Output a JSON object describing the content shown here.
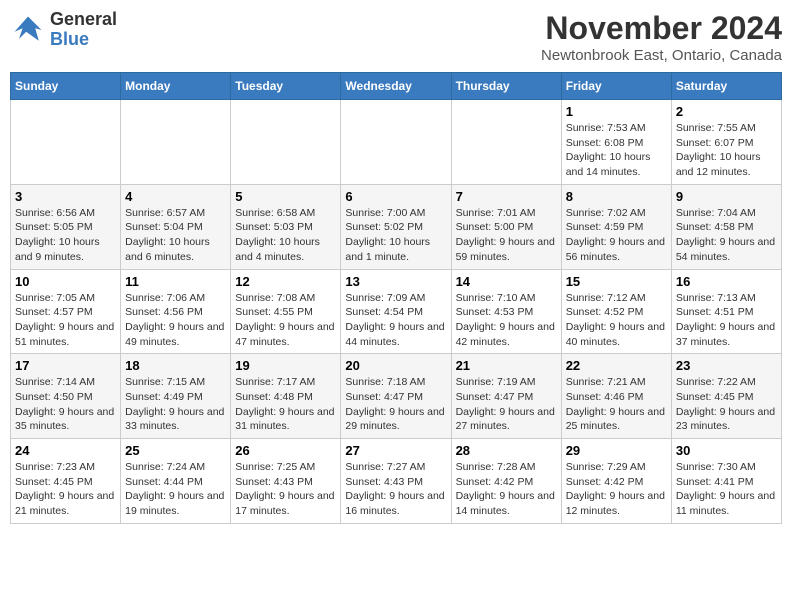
{
  "logo": {
    "line1": "General",
    "line2": "Blue"
  },
  "title": "November 2024",
  "subtitle": "Newtonbrook East, Ontario, Canada",
  "days_of_week": [
    "Sunday",
    "Monday",
    "Tuesday",
    "Wednesday",
    "Thursday",
    "Friday",
    "Saturday"
  ],
  "weeks": [
    [
      {
        "day": "",
        "info": ""
      },
      {
        "day": "",
        "info": ""
      },
      {
        "day": "",
        "info": ""
      },
      {
        "day": "",
        "info": ""
      },
      {
        "day": "",
        "info": ""
      },
      {
        "day": "1",
        "info": "Sunrise: 7:53 AM\nSunset: 6:08 PM\nDaylight: 10 hours and 14 minutes."
      },
      {
        "day": "2",
        "info": "Sunrise: 7:55 AM\nSunset: 6:07 PM\nDaylight: 10 hours and 12 minutes."
      }
    ],
    [
      {
        "day": "3",
        "info": "Sunrise: 6:56 AM\nSunset: 5:05 PM\nDaylight: 10 hours and 9 minutes."
      },
      {
        "day": "4",
        "info": "Sunrise: 6:57 AM\nSunset: 5:04 PM\nDaylight: 10 hours and 6 minutes."
      },
      {
        "day": "5",
        "info": "Sunrise: 6:58 AM\nSunset: 5:03 PM\nDaylight: 10 hours and 4 minutes."
      },
      {
        "day": "6",
        "info": "Sunrise: 7:00 AM\nSunset: 5:02 PM\nDaylight: 10 hours and 1 minute."
      },
      {
        "day": "7",
        "info": "Sunrise: 7:01 AM\nSunset: 5:00 PM\nDaylight: 9 hours and 59 minutes."
      },
      {
        "day": "8",
        "info": "Sunrise: 7:02 AM\nSunset: 4:59 PM\nDaylight: 9 hours and 56 minutes."
      },
      {
        "day": "9",
        "info": "Sunrise: 7:04 AM\nSunset: 4:58 PM\nDaylight: 9 hours and 54 minutes."
      }
    ],
    [
      {
        "day": "10",
        "info": "Sunrise: 7:05 AM\nSunset: 4:57 PM\nDaylight: 9 hours and 51 minutes."
      },
      {
        "day": "11",
        "info": "Sunrise: 7:06 AM\nSunset: 4:56 PM\nDaylight: 9 hours and 49 minutes."
      },
      {
        "day": "12",
        "info": "Sunrise: 7:08 AM\nSunset: 4:55 PM\nDaylight: 9 hours and 47 minutes."
      },
      {
        "day": "13",
        "info": "Sunrise: 7:09 AM\nSunset: 4:54 PM\nDaylight: 9 hours and 44 minutes."
      },
      {
        "day": "14",
        "info": "Sunrise: 7:10 AM\nSunset: 4:53 PM\nDaylight: 9 hours and 42 minutes."
      },
      {
        "day": "15",
        "info": "Sunrise: 7:12 AM\nSunset: 4:52 PM\nDaylight: 9 hours and 40 minutes."
      },
      {
        "day": "16",
        "info": "Sunrise: 7:13 AM\nSunset: 4:51 PM\nDaylight: 9 hours and 37 minutes."
      }
    ],
    [
      {
        "day": "17",
        "info": "Sunrise: 7:14 AM\nSunset: 4:50 PM\nDaylight: 9 hours and 35 minutes."
      },
      {
        "day": "18",
        "info": "Sunrise: 7:15 AM\nSunset: 4:49 PM\nDaylight: 9 hours and 33 minutes."
      },
      {
        "day": "19",
        "info": "Sunrise: 7:17 AM\nSunset: 4:48 PM\nDaylight: 9 hours and 31 minutes."
      },
      {
        "day": "20",
        "info": "Sunrise: 7:18 AM\nSunset: 4:47 PM\nDaylight: 9 hours and 29 minutes."
      },
      {
        "day": "21",
        "info": "Sunrise: 7:19 AM\nSunset: 4:47 PM\nDaylight: 9 hours and 27 minutes."
      },
      {
        "day": "22",
        "info": "Sunrise: 7:21 AM\nSunset: 4:46 PM\nDaylight: 9 hours and 25 minutes."
      },
      {
        "day": "23",
        "info": "Sunrise: 7:22 AM\nSunset: 4:45 PM\nDaylight: 9 hours and 23 minutes."
      }
    ],
    [
      {
        "day": "24",
        "info": "Sunrise: 7:23 AM\nSunset: 4:45 PM\nDaylight: 9 hours and 21 minutes."
      },
      {
        "day": "25",
        "info": "Sunrise: 7:24 AM\nSunset: 4:44 PM\nDaylight: 9 hours and 19 minutes."
      },
      {
        "day": "26",
        "info": "Sunrise: 7:25 AM\nSunset: 4:43 PM\nDaylight: 9 hours and 17 minutes."
      },
      {
        "day": "27",
        "info": "Sunrise: 7:27 AM\nSunset: 4:43 PM\nDaylight: 9 hours and 16 minutes."
      },
      {
        "day": "28",
        "info": "Sunrise: 7:28 AM\nSunset: 4:42 PM\nDaylight: 9 hours and 14 minutes."
      },
      {
        "day": "29",
        "info": "Sunrise: 7:29 AM\nSunset: 4:42 PM\nDaylight: 9 hours and 12 minutes."
      },
      {
        "day": "30",
        "info": "Sunrise: 7:30 AM\nSunset: 4:41 PM\nDaylight: 9 hours and 11 minutes."
      }
    ]
  ]
}
